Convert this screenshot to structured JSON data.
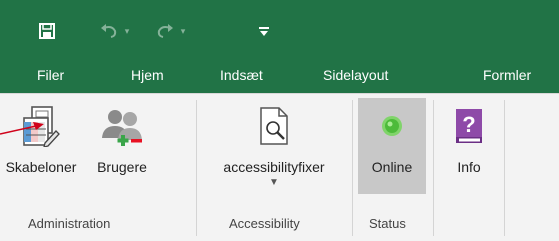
{
  "quick_access": {
    "save_icon": "save-icon",
    "undo_icon": "undo-icon",
    "redo_icon": "redo-icon",
    "customize_icon": "customize-quick-access-icon"
  },
  "tabs": [
    "Filer",
    "Hjem",
    "Indsæt",
    "Sidelayout",
    "Formler"
  ],
  "groups": {
    "administration": {
      "label": "Administration",
      "buttons": [
        {
          "label": "Skabeloner",
          "icon": "templates-icon"
        },
        {
          "label": "Brugere",
          "icon": "users-icon"
        }
      ]
    },
    "accessibility": {
      "label": "Accessibility",
      "button": {
        "label": "accessibilityfixer",
        "icon": "magnifier-document-icon"
      }
    },
    "status": {
      "label": "Status",
      "button": {
        "label": "Online",
        "icon": "status-online-icon"
      }
    },
    "info": {
      "button": {
        "label": "Info",
        "icon": "help-book-icon"
      }
    }
  },
  "colors": {
    "title_bar": "#217346",
    "online_indicator": "#4dbb3a",
    "info_icon": "#8e4aa8",
    "arrow": "#d0021b"
  }
}
